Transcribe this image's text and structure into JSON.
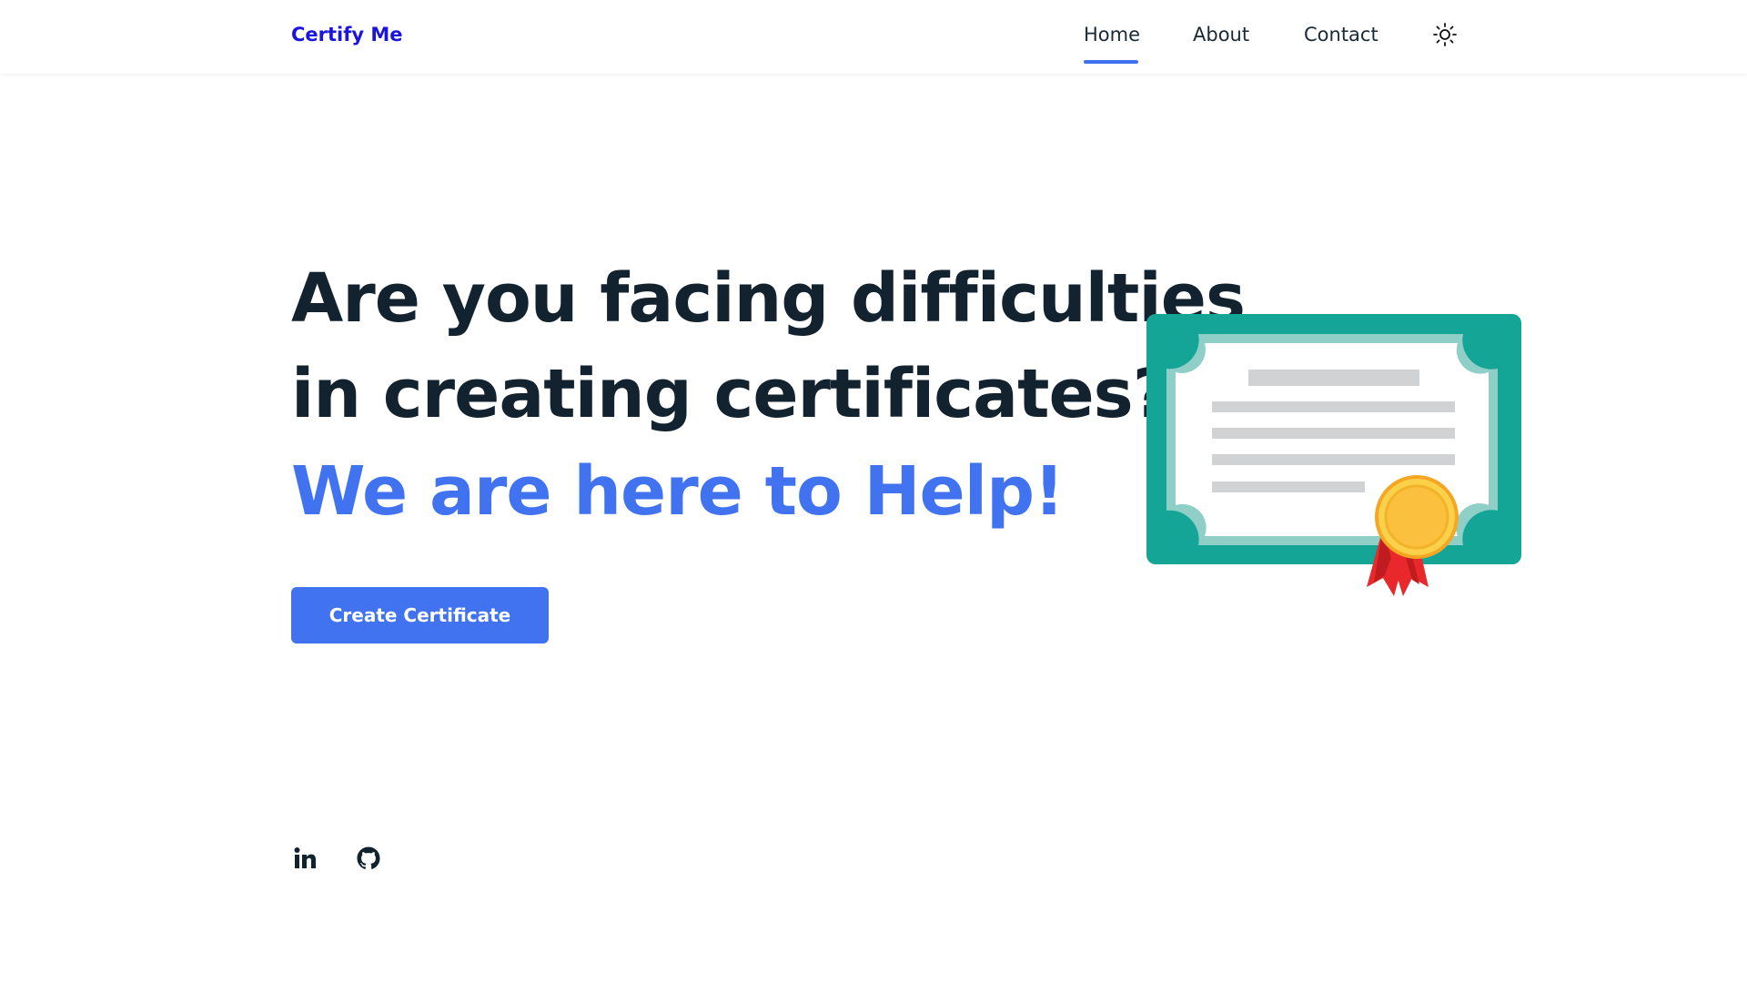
{
  "navbar": {
    "brand": "Certify Me",
    "links": [
      {
        "label": "Home",
        "active": true
      },
      {
        "label": "About",
        "active": false
      },
      {
        "label": "Contact",
        "active": false
      }
    ],
    "theme_toggle_icon": "sun-icon"
  },
  "hero": {
    "line1": "Are you facing difficulties",
    "line2": "in creating certificates?",
    "line3": "We are here to Help!",
    "cta_label": "Create Certificate"
  },
  "illustration_icon": "certificate-icon",
  "social": [
    {
      "icon": "linkedin-icon"
    },
    {
      "icon": "github-icon"
    }
  ],
  "colors": {
    "brand": "#1a14e0",
    "accent": "#4173f1",
    "heading": "#12222e",
    "certificate_frame": "#14a597",
    "ribbon": "#e8282a",
    "medal": "#fbc03e"
  }
}
